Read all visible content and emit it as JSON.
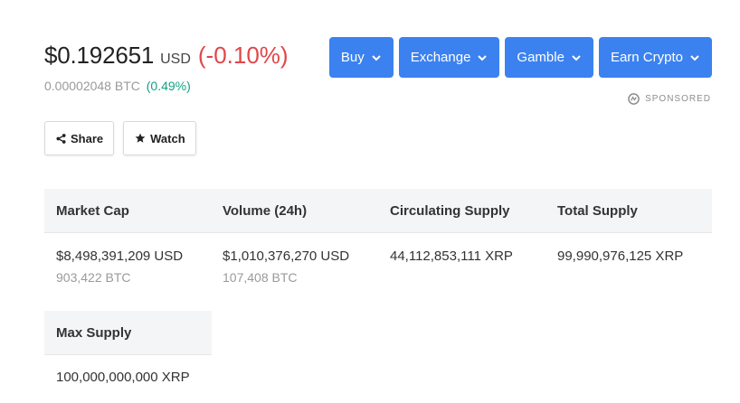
{
  "price": {
    "value": "$0.192651",
    "currency": "USD",
    "change": "(-0.10%)",
    "btc_value": "0.00002048 BTC",
    "btc_change": "(0.49%)"
  },
  "actions": [
    {
      "label": "Buy"
    },
    {
      "label": "Exchange"
    },
    {
      "label": "Gamble"
    },
    {
      "label": "Earn Crypto"
    }
  ],
  "sponsored_label": "SPONSORED",
  "buttons": {
    "share": "Share",
    "watch": "Watch"
  },
  "stats": {
    "headers": [
      "Market Cap",
      "Volume (24h)",
      "Circulating Supply",
      "Total Supply"
    ],
    "values": [
      {
        "main": "$8,498,391,209 USD",
        "sub": "903,422 BTC"
      },
      {
        "main": "$1,010,376,270 USD",
        "sub": "107,408 BTC"
      },
      {
        "main": "44,112,853,111 XRP",
        "sub": ""
      },
      {
        "main": "99,990,976,125 XRP",
        "sub": ""
      }
    ],
    "max_supply": {
      "header": "Max Supply",
      "value": "100,000,000,000 XRP"
    }
  },
  "colors": {
    "accent": "#3b82f0",
    "negative": "#e0474a",
    "positive": "#16a086",
    "header_bg": "#f4f5f7"
  },
  "icons": {
    "chevron": "chevron-down-icon",
    "share": "share-icon",
    "watch": "star-icon",
    "sponsor": "coinzilla-logo-icon"
  }
}
